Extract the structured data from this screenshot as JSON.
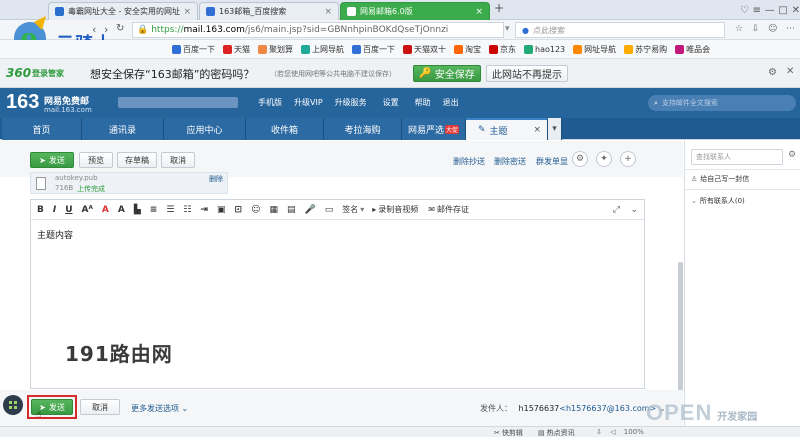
{
  "browser": {
    "tabs": [
      {
        "label": "毒霸网址大全 - 安全实用的网址"
      },
      {
        "label": "163邮箱_百度搜索"
      },
      {
        "label": "网易邮箱6.0版"
      }
    ],
    "new_tab": "+",
    "url_scheme": "https://",
    "url_host": "mail.163.com",
    "url_rest": "/js6/main.jsp?sid=GBNnhpinBOKdQseTjOnnzi",
    "search_placeholder": "点此搜索"
  },
  "watermark_logo": "云骑士",
  "bookmarks": [
    {
      "label": "百度一下",
      "color": "#2f6fd6"
    },
    {
      "label": "天猫",
      "color": "#d22"
    },
    {
      "label": "聚划算",
      "color": "#e84"
    },
    {
      "label": "上网导航",
      "color": "#2a9"
    },
    {
      "label": "百度一下",
      "color": "#2f6fd6"
    },
    {
      "label": "天猫双十",
      "color": "#c11"
    },
    {
      "label": "淘宝",
      "color": "#f60"
    },
    {
      "label": "京东",
      "color": "#c00"
    },
    {
      "label": "hao123",
      "color": "#2a7"
    },
    {
      "label": "网址导航",
      "color": "#f80"
    },
    {
      "label": "苏宁易购",
      "color": "#fa0"
    },
    {
      "label": "唯品会",
      "color": "#c2187a"
    }
  ],
  "bar360": {
    "brand": "360",
    "brand_sub": "登录管家",
    "prompt": "想安全保存“163邮箱”的密码吗？",
    "hint": "（若您使用网吧等公共电脑不建议保存）",
    "save": "安全保存",
    "dismiss": "此网站不再提示"
  },
  "mail_header": {
    "logo_big": "163",
    "logo_title": "网易免费邮",
    "logo_domain": "mail.163.com",
    "links": [
      "手机版",
      "升级VIP",
      "升级服务",
      "设置",
      "帮助",
      "退出"
    ],
    "search_placeholder": "支持邮件全文搜索"
  },
  "nav_tabs": [
    {
      "label": "首页"
    },
    {
      "label": "通讯录"
    },
    {
      "label": "应用中心"
    },
    {
      "label": "收件箱"
    },
    {
      "label": "考拉海购"
    },
    {
      "label": "网易严选",
      "badge": "大促"
    },
    {
      "label": "主题"
    }
  ],
  "compose": {
    "send": "发送",
    "preview": "预览",
    "save_draft": "存草稿",
    "cancel": "取消",
    "remove_cc": "删除抄送",
    "remove_bcc": "删除密送",
    "separate_send": "群发单显",
    "attachment_name": "autokey.pub",
    "attachment_size": "716B",
    "attachment_status": "上传完成",
    "attachment_delete": "删除",
    "toolbar_signature": "签名",
    "toolbar_video": "录制音视频",
    "toolbar_deposit": "邮件存证",
    "body_text": "主题内容",
    "watermark": "191路由网",
    "bottom_send": "发送",
    "bottom_cancel": "取消",
    "more_options": "更多发送选项",
    "sender_label": "发件人：",
    "sender_name": "h1576637",
    "sender_email": "<h1576637@163.com>"
  },
  "contacts": {
    "search_placeholder": "查找联系人",
    "write_self": "给自己写一封信",
    "all_contacts": "所有联系人(0)"
  },
  "statusbar": {
    "speedup": "快剪辑",
    "hot": "热点资讯",
    "zoom": "100%",
    "open_logo": "OPEN",
    "open_sub": "开发家园"
  }
}
